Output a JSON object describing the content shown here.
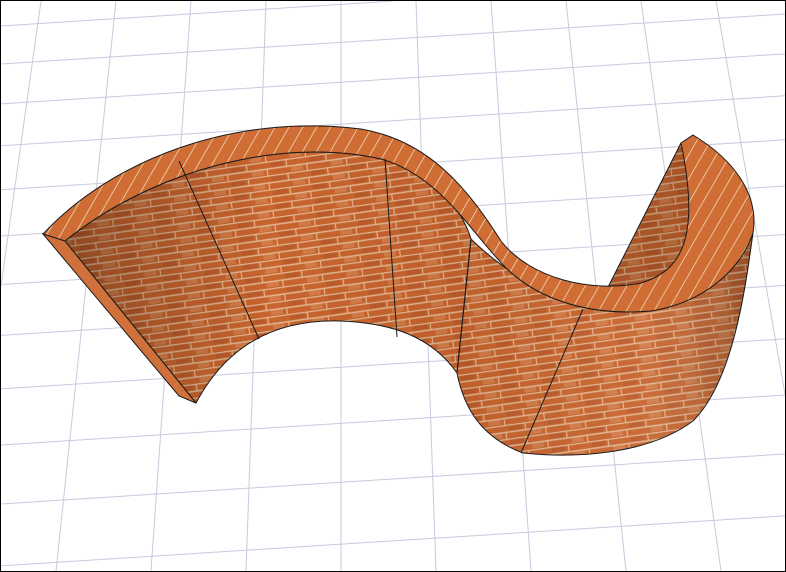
{
  "viewport": {
    "view": "3d-perspective",
    "object": "curved-brick-wall",
    "colors": {
      "grid": "#c9c9de",
      "brick": "#c8642e",
      "brick_dark": "#a94f22",
      "mortar": "#e0b38a",
      "edge": "#1a1a1a",
      "background": "#ffffff"
    }
  }
}
